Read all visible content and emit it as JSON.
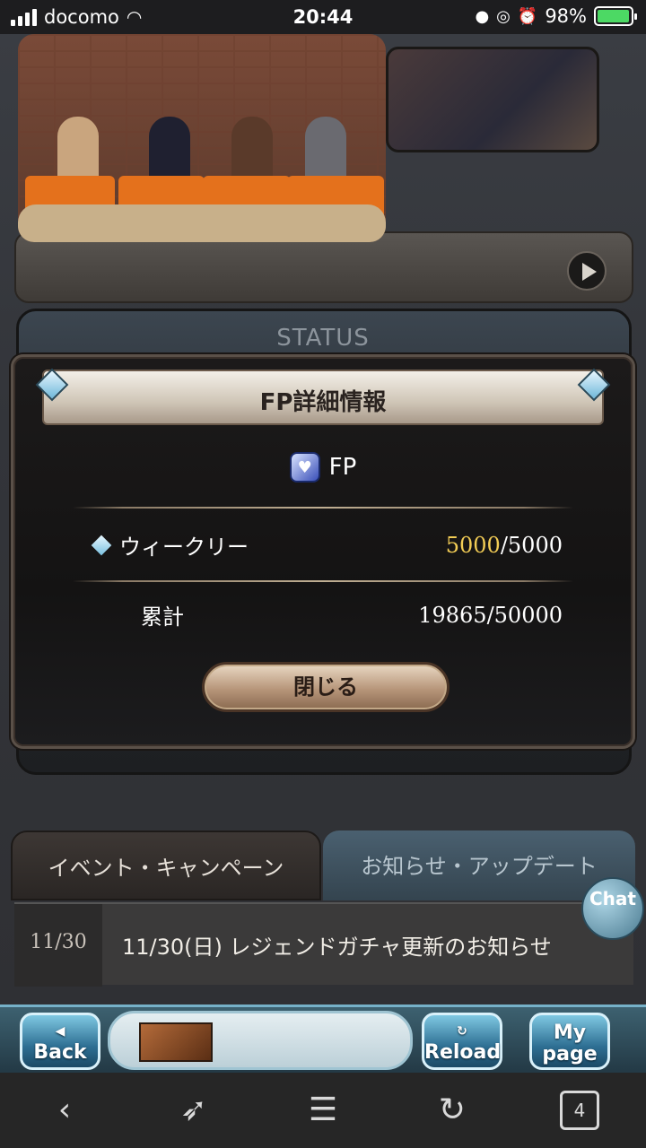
{
  "status_bar": {
    "carrier": "docomo",
    "time": "20:44",
    "battery": "98%",
    "battery_level": 0.98
  },
  "background": {
    "status_title": "STATUS"
  },
  "modal": {
    "title": "FP詳細情報",
    "item_name": "FP",
    "rows": [
      {
        "label": "ウィークリー",
        "current": "5000",
        "max": "/5000"
      },
      {
        "label": "累計",
        "value": "19865/50000"
      }
    ],
    "close_label": "閉じる"
  },
  "news": {
    "tabs": [
      {
        "label": "イベント・キャンペーン",
        "active": true
      },
      {
        "label": "お知らせ・アップデート",
        "active": false
      }
    ],
    "chat_label": "Chat",
    "items": [
      {
        "date": "11/30",
        "text": "11/30(日) レジェンドガチャ更新のお知らせ"
      }
    ]
  },
  "game_nav": {
    "back": "Back",
    "reload": "Reload",
    "mypage": "My page"
  },
  "browser_toolbar": {
    "tab_count": "4"
  }
}
